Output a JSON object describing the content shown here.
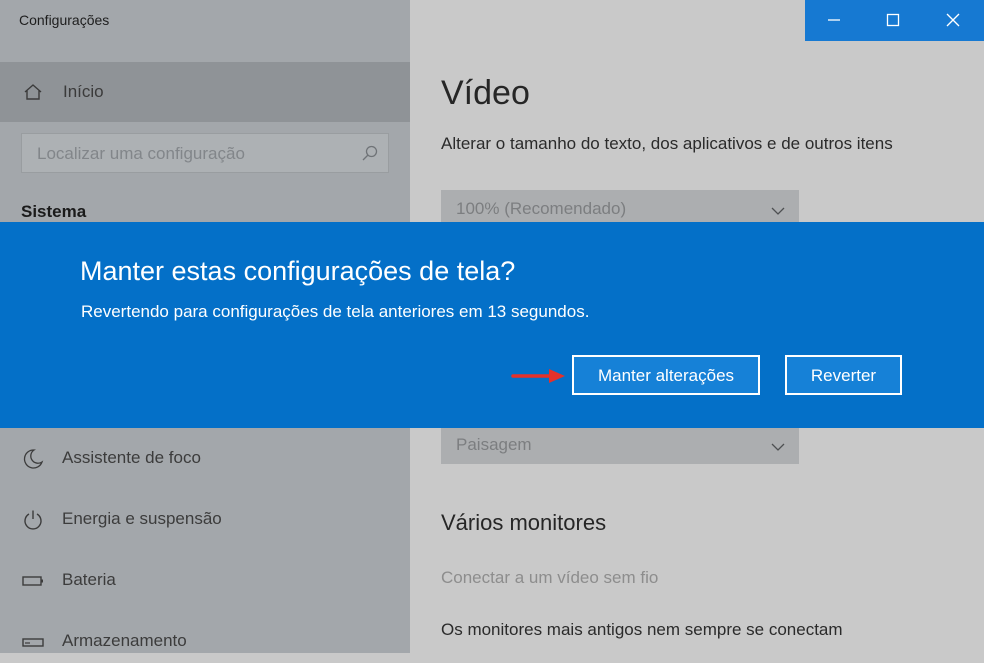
{
  "window": {
    "title": "Configurações"
  },
  "sidebar": {
    "home_label": "Início",
    "search_placeholder": "Localizar uma configuração",
    "section_label": "Sistema",
    "items": [
      {
        "label": "Assistente de foco",
        "icon": "moon-icon"
      },
      {
        "label": "Energia e suspensão",
        "icon": "power-icon"
      },
      {
        "label": "Bateria",
        "icon": "battery-icon"
      },
      {
        "label": "Armazenamento",
        "icon": "storage-icon"
      }
    ]
  },
  "main": {
    "title": "Vídeo",
    "scale_description": "Alterar o tamanho do texto, dos aplicativos e de outros itens",
    "scale_value": "100% (Recomendado)",
    "orientation_value": "Paisagem",
    "multi_monitor_title": "Vários monitores",
    "wireless_link": "Conectar a um vídeo sem fio",
    "old_monitors_text": "Os monitores mais antigos nem sempre se conectam"
  },
  "dialog": {
    "title": "Manter estas configurações de tela?",
    "message": "Revertendo para configurações de tela anteriores em 13 segundos.",
    "keep_label": "Manter alterações",
    "revert_label": "Reverter"
  },
  "colors": {
    "dialog_bg": "#0470c8",
    "caption_bg": "#1679d2",
    "annotation_arrow": "#e5312a"
  }
}
